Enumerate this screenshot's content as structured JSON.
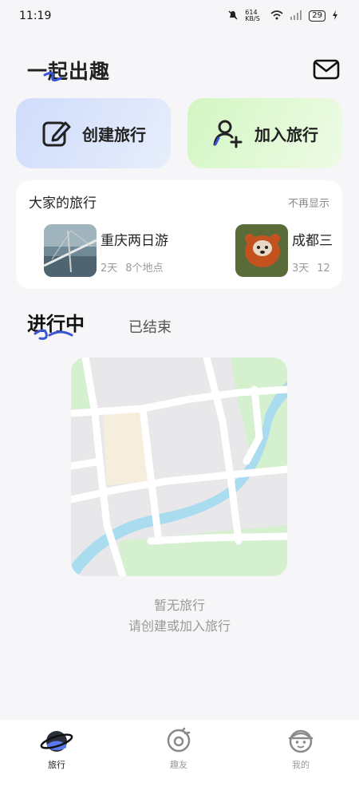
{
  "status_bar": {
    "time": "11:19",
    "network_speed": "614 KB/S",
    "battery": "29"
  },
  "header": {
    "title": "一起出趣",
    "mail_icon": "mail-icon"
  },
  "actions": {
    "create_label": "创建旅行",
    "join_label": "加入旅行",
    "create_icon": "edit-icon",
    "join_icon": "add-user-icon"
  },
  "everyone": {
    "title": "大家的旅行",
    "dismiss_label": "不再显示",
    "trips": [
      {
        "name": "重庆两日游",
        "days": "2天",
        "places": "8个地点"
      },
      {
        "name": "成都三",
        "days": "3天",
        "places": "12"
      }
    ]
  },
  "tabs": {
    "active": "进行中",
    "inactive": "已结束"
  },
  "empty_state": {
    "title": "暂无旅行",
    "subtitle": "请创建或加入旅行"
  },
  "bottom_nav": {
    "items": [
      {
        "label": "旅行",
        "icon": "planet-icon",
        "active": true
      },
      {
        "label": "趣友",
        "icon": "friends-icon",
        "active": false
      },
      {
        "label": "我的",
        "icon": "profile-icon",
        "active": false
      }
    ]
  },
  "colors": {
    "background": "#f6f6f8",
    "create_card": "#d6e2fb",
    "join_card": "#d9f7c9",
    "accent_blue": "#3a56d6"
  }
}
